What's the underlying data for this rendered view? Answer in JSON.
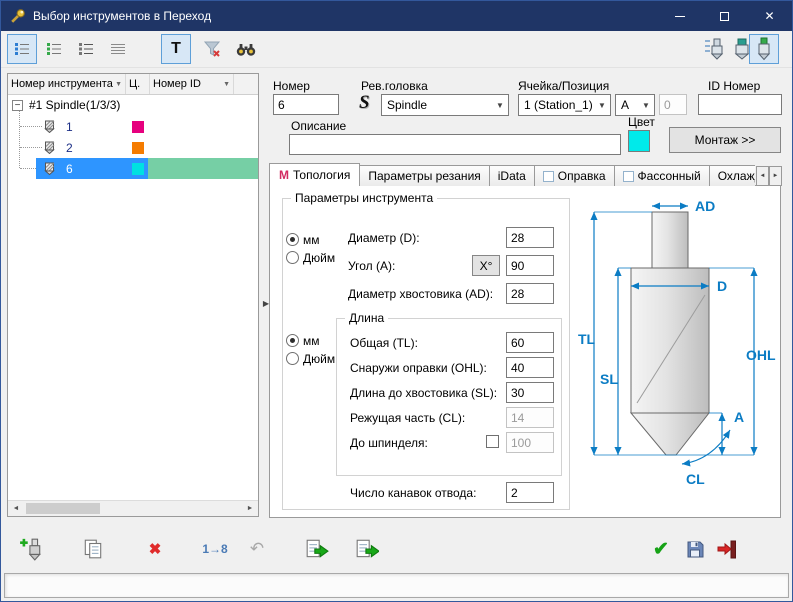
{
  "window": {
    "title": "Выбор инструментов в Переход"
  },
  "icons": {
    "sort": "▼",
    "combo_arrow": "▼",
    "expander": "−",
    "splitter": "▶",
    "scroll_left": "◄",
    "scroll_right": "►",
    "delete": "✖",
    "undo": "↶",
    "check": "✔",
    "close": "✕"
  },
  "top_toolbar": {
    "t_button": "T"
  },
  "tool_table": {
    "columns": [
      {
        "label": "Номер инструмента"
      },
      {
        "label": "Ц."
      },
      {
        "label": "Номер ID"
      }
    ],
    "group_label": "#1 Spindle(1/3/3)",
    "rows": [
      {
        "number": "1",
        "color": "#e6007e"
      },
      {
        "number": "2",
        "color": "#f57c00"
      },
      {
        "number": "6",
        "color": "#00e1e1"
      }
    ],
    "selection": {
      "row_bg": "#2e95ff",
      "id_cell_bg": "#76cfa5"
    }
  },
  "form": {
    "number": {
      "label": "Номер",
      "value": "6"
    },
    "rev_head": {
      "label": "Рев.головка",
      "icon": "S",
      "value": "Spindle"
    },
    "cell_position": {
      "label": "Ячейка/Позиция",
      "station": "1 (Station_1)",
      "position": "A",
      "index": "0"
    },
    "id_number": {
      "label": "ID Номер",
      "value": ""
    },
    "description": {
      "label": "Описание",
      "value": ""
    },
    "color": {
      "label": "Цвет",
      "value": "#00eaea"
    },
    "mount_button": "Монтаж >>"
  },
  "tabs": {
    "items": [
      {
        "label": "Топология",
        "icon": "M"
      },
      {
        "label": "Параметры резания"
      },
      {
        "label": "iData"
      },
      {
        "label": "Оправка",
        "has_checkbox": true
      },
      {
        "label": "Фассонный",
        "has_checkbox": true
      },
      {
        "label": "Охлаждение"
      }
    ]
  },
  "topology": {
    "group_title": "Параметры инструмента",
    "units_mm": "мм",
    "units_inch": "Дюйм",
    "diameter": {
      "label": "Диаметр (D):",
      "value": "28"
    },
    "angle": {
      "label": "Угол (A):",
      "button": "X°",
      "value": "90"
    },
    "shank_diameter": {
      "label": "Диаметр хвостовика (AD):",
      "value": "28"
    },
    "length": {
      "title": "Длина",
      "total": {
        "label": "Общая (TL):",
        "value": "60"
      },
      "outside_holder": {
        "label": "Снаружи оправки (OHL):",
        "value": "40"
      },
      "to_shank": {
        "label": "Длина до хвостовика (SL):",
        "value": "30"
      },
      "cutting": {
        "label": "Режущая часть (CL):",
        "value": "14"
      },
      "to_spindle": {
        "label": "До шпинделя:",
        "value": "100"
      }
    },
    "flutes": {
      "label": "Число канавок отвода:",
      "value": "2"
    }
  },
  "diagram": {
    "dimension_color": "#0b7cc4",
    "labels": {
      "ad": "AD",
      "d": "D",
      "tl": "TL",
      "sl": "SL",
      "ohl": "OHL",
      "a": "A",
      "cl": "CL"
    }
  },
  "bottom_toolbar": {
    "renumber_label": "1→8"
  }
}
